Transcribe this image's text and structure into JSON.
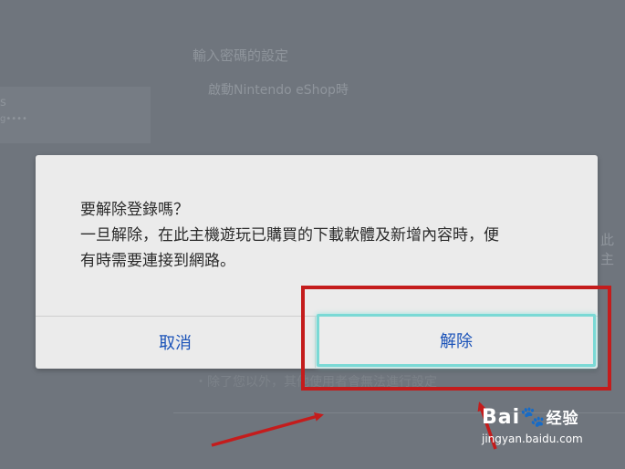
{
  "background": {
    "section_title": "輸入密碼的設定",
    "subtitle": "啟動Nintendo eShop時",
    "left_fragment_1": "s",
    "left_fragment_2": "g••••",
    "right_fragment": "此主",
    "bottom_note": "・除了您以外，其他使用者會無法進行設定"
  },
  "dialog": {
    "lines": [
      "要解除登錄嗎？",
      "一旦解除，在此主機遊玩已購買的下載軟體及新增內容時，便",
      "有時需要連接到網路。"
    ],
    "cancel_label": "取消",
    "confirm_label": "解除"
  },
  "watermark": {
    "logo_text": "Bai",
    "logo_suffix": "经验",
    "url": "jingyan.baidu.com"
  },
  "colors": {
    "overlay": "#6f757d",
    "dialog_bg": "#ebebeb",
    "button_text": "#1a52b8",
    "focus_border": "#7ad9d5",
    "annotation_red": "#c41c1c"
  }
}
